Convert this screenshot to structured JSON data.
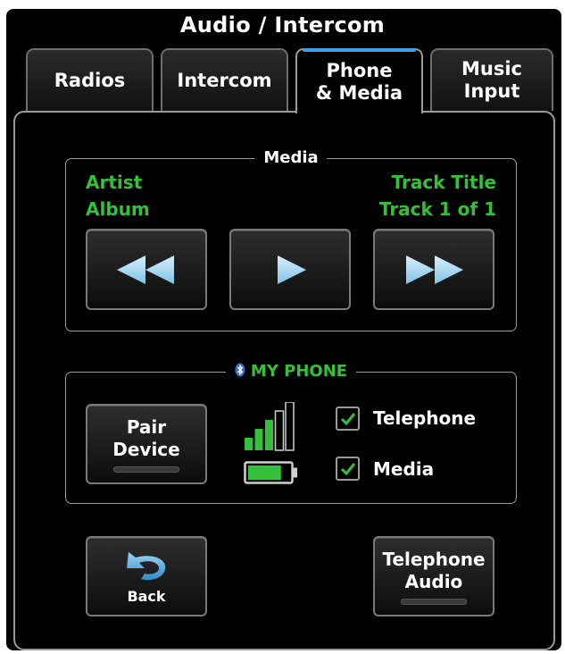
{
  "header": {
    "title": "Audio / Intercom"
  },
  "tabs": [
    {
      "label": "Radios",
      "active": false
    },
    {
      "label": "Intercom",
      "active": false
    },
    {
      "label": "Phone\n& Media",
      "active": true
    },
    {
      "label": "Music\nInput",
      "active": false
    }
  ],
  "media": {
    "label": "Media",
    "artist": "Artist",
    "album": "Album",
    "track_title": "Track Title",
    "track_position": "Track 1 of 1",
    "controls": [
      "rewind-icon",
      "play-icon",
      "fast-forward-icon"
    ]
  },
  "phone": {
    "label": "MY PHONE",
    "pair_button": "Pair\nDevice",
    "signal_bars_active": 3,
    "signal_bars_total": 5,
    "battery_level": 0.8,
    "options": [
      {
        "label": "Telephone",
        "checked": true
      },
      {
        "label": "Media",
        "checked": true
      }
    ]
  },
  "footer": {
    "back_label": "Back",
    "telephone_audio_label": "Telephone\nAudio"
  },
  "colors": {
    "accent_green": "#34c03a",
    "active_tab_bar": "#3aa0e8",
    "bluetooth": "#3a6ad8"
  }
}
